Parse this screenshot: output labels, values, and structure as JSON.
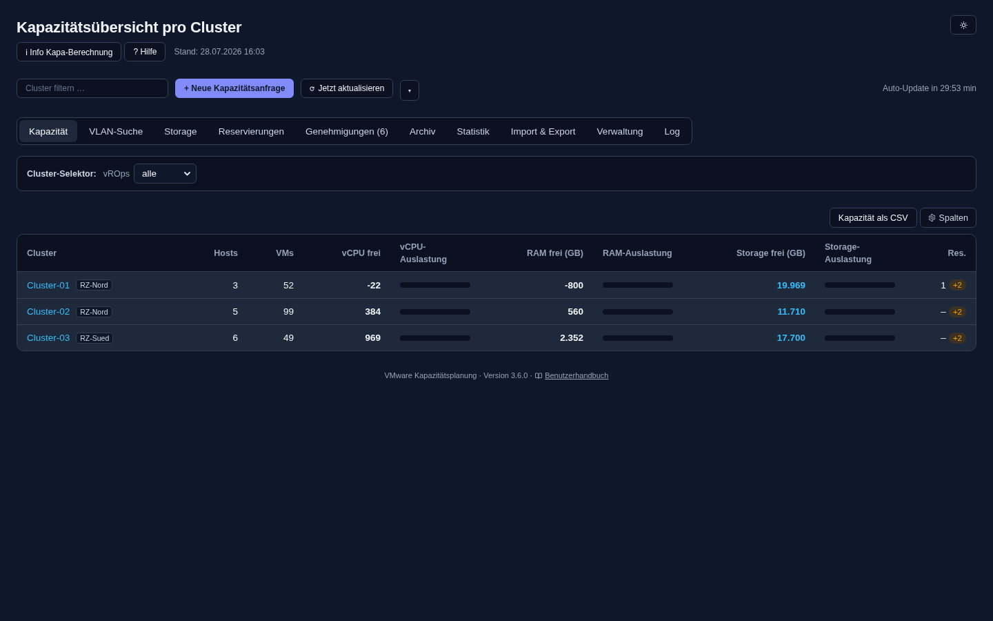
{
  "header": {
    "title": "Kapazitätsübersicht pro Cluster"
  },
  "info_bar": {
    "buttons": [
      "ℹ Info Kapa-Berechnung",
      "? Hilfe"
    ],
    "timestamp": "Stand: 28.07.2026 16:03"
  },
  "toolbar": {
    "filter": {
      "placeholder": "Cluster filtern …"
    },
    "buttons": [
      {
        "label": "+ Neue Kapazitätsanfrage",
        "kind": "primary"
      },
      {
        "label": "Jetzt aktualisieren",
        "kind": "refresh"
      },
      {
        "label": "▾",
        "kind": "menu"
      }
    ],
    "auto_update": "Auto-Update in 29:53 min"
  },
  "tabs": [
    {
      "label": "Kapazität",
      "selected": true
    },
    {
      "label": "VLAN-Suche",
      "selected": false
    },
    {
      "label": "Storage",
      "selected": false
    },
    {
      "label": "Reservierungen",
      "selected": false
    },
    {
      "label": "Genehmigungen (6)",
      "selected": false
    },
    {
      "label": "Archiv",
      "selected": false
    },
    {
      "label": "Statistik",
      "selected": false
    },
    {
      "label": "Import & Export",
      "selected": false
    },
    {
      "label": "Verwaltung",
      "selected": false
    },
    {
      "label": "Log",
      "selected": false
    }
  ],
  "cluster_selector": {
    "label": "Cluster-Selektor:",
    "source": "vROps",
    "value": "alle"
  },
  "table_actions": [
    {
      "label": "Kapazität als CSV",
      "kind": "plain"
    },
    {
      "label": "Spalten",
      "kind": "columns"
    }
  ],
  "table": {
    "columns": [
      "Cluster",
      "Hosts",
      "VMs",
      "vCPU frei",
      "vCPU-Auslastung",
      "RAM frei (GB)",
      "RAM-Auslastung",
      "Storage frei (GB)",
      "Storage-Auslastung",
      "Res."
    ],
    "rows": [
      {
        "cluster": "Cluster-01",
        "site": "RZ-Nord",
        "hosts": "3",
        "vms": "52",
        "vcpu_free": "-22",
        "ram_free": "-800",
        "storage_free": "19.969",
        "reservations": "1",
        "pending": "+2"
      },
      {
        "cluster": "Cluster-02",
        "site": "RZ-Nord",
        "hosts": "5",
        "vms": "99",
        "vcpu_free": "384",
        "ram_free": "560",
        "storage_free": "11.710",
        "reservations": "–",
        "pending": "+2"
      },
      {
        "cluster": "Cluster-03",
        "site": "RZ-Sued",
        "hosts": "6",
        "vms": "49",
        "vcpu_free": "969",
        "ram_free": "2.352",
        "storage_free": "17.700",
        "reservations": "–",
        "pending": "+2"
      }
    ]
  },
  "footer": {
    "text": "VMware Kapazitätsplanung · Version 3.6.0 ·",
    "link": "Benutzerhandbuch"
  }
}
